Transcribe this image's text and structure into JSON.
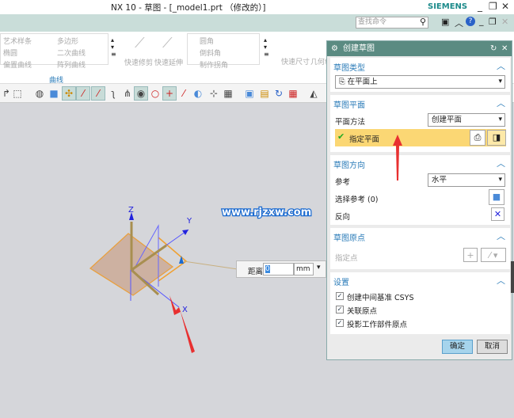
{
  "window": {
    "title": "NX 10 - 草图 - [_model1.prt （修改的）]",
    "brand": "SIEMENS",
    "search_placeholder": "查找命令"
  },
  "ribbon": {
    "curve_items": [
      "艺术样条",
      "多边形",
      "椭圆",
      "二次曲线",
      "偏置曲线",
      "阵列曲线"
    ],
    "quick_trim": "快速修剪",
    "quick_extend": "快速延伸",
    "corner_items": [
      "圆角",
      "倒斜角",
      "制作拐角"
    ],
    "quick_dim": "快速尺寸",
    "geom": "几何约",
    "group_label": "曲线"
  },
  "viewport": {
    "watermark": "www.rjzxw.com",
    "axis_labels": {
      "z": "Z",
      "y": "Y",
      "x": "X"
    },
    "distance": {
      "label": "距离",
      "value": "0",
      "unit": "mm"
    }
  },
  "dialog": {
    "title": "创建草图",
    "sketch_type": {
      "header": "草图类型",
      "value": "在平面上"
    },
    "sketch_plane": {
      "header": "草图平面",
      "method_label": "平面方法",
      "method_value": "创建平面",
      "specify_label": "指定平面"
    },
    "sketch_orientation": {
      "header": "草图方向",
      "ref_label": "参考",
      "ref_value": "水平",
      "select_ref": "选择参考 (0)",
      "reverse": "反向"
    },
    "sketch_origin": {
      "header": "草图原点",
      "specify_point": "指定点"
    },
    "settings": {
      "header": "设置",
      "options": [
        {
          "label": "创建中间基准 CSYS",
          "checked": true
        },
        {
          "label": "关联原点",
          "checked": true
        },
        {
          "label": "投影工作部件原点",
          "checked": true
        }
      ]
    },
    "ok": "确定",
    "cancel": "取消"
  },
  "colors": {
    "dialog_header": "#5b8b82",
    "accent": "#2a7bb8",
    "highlight": "#fbd774",
    "plane": "#e8a040"
  }
}
